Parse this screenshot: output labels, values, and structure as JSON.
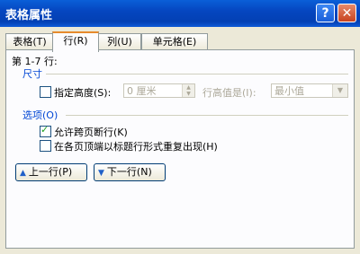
{
  "window": {
    "title": "表格属性",
    "help_label": "?",
    "close_label": "✕"
  },
  "tabs": [
    {
      "label": "表格(T)",
      "active": false
    },
    {
      "label": "行(R)",
      "active": true
    },
    {
      "label": "列(U)",
      "active": false
    },
    {
      "label": "单元格(E)",
      "active": false
    }
  ],
  "row_tab": {
    "rows_label": "第 1-7 行:",
    "size_section": "尺寸",
    "specify_height": {
      "label": "指定高度(S):",
      "checked": false
    },
    "height_value": "0 厘米",
    "row_height_is_label": "行高值是(I):",
    "row_height_is_value": "最小值",
    "options_section": "选项(O)",
    "allow_break": {
      "label": "允许跨页断行(K)",
      "checked": true
    },
    "repeat_header": {
      "label": "在各页顶端以标题行形式重复出现(H)",
      "checked": false
    },
    "prev_row_button": "上一行(P)",
    "next_row_button": "下一行(N)"
  },
  "colors": {
    "title_bar": "#0546c0",
    "section_label": "#0046d5",
    "active_tab_accent": "#e68b2c"
  }
}
